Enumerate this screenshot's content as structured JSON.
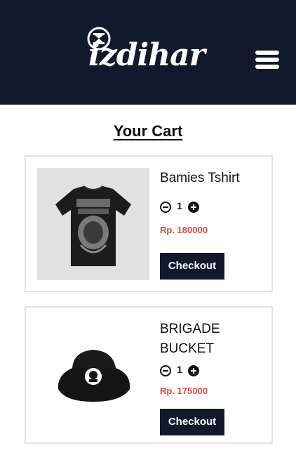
{
  "header": {
    "brand": "izdihar",
    "logo_icon": "hourglass-emblem-icon",
    "menu_icon": "hamburger-menu-icon",
    "background": "#111a2c"
  },
  "page": {
    "title": "Your Cart"
  },
  "cart": {
    "items": [
      {
        "name": "Bamies Tshirt",
        "quantity": "1",
        "price": "Rp. 180000",
        "image": "black-tshirt-image",
        "checkout_label": "Checkout"
      },
      {
        "name": "BRIGADE BUCKET",
        "quantity": "1",
        "price": "Rp. 175000",
        "image": "black-bucket-hat-image",
        "checkout_label": "Checkout"
      }
    ]
  },
  "colors": {
    "price": "#d9473f",
    "button": "#111a2c"
  }
}
